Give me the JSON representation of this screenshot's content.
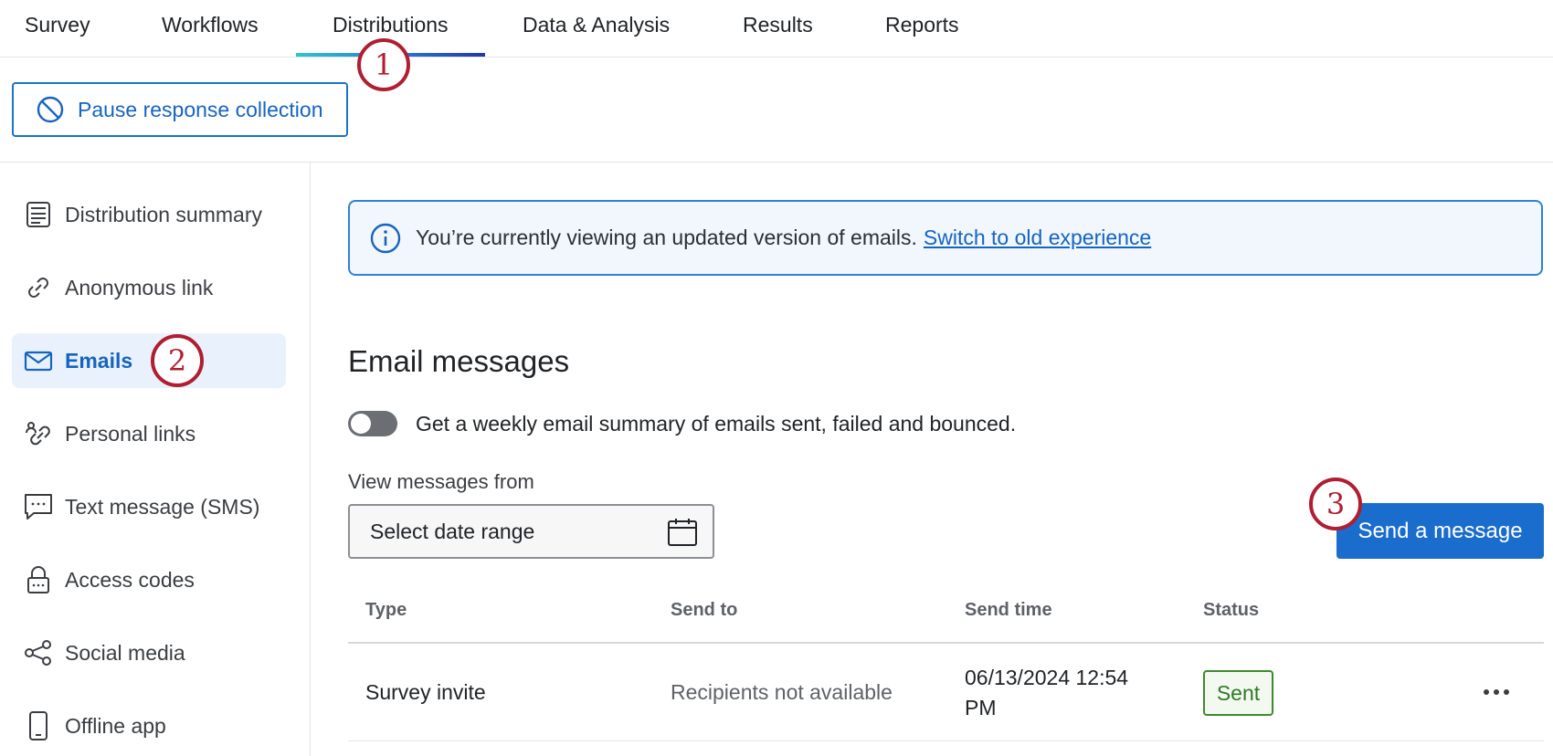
{
  "nav": {
    "tabs": [
      {
        "label": "Survey"
      },
      {
        "label": "Workflows"
      },
      {
        "label": "Distributions"
      },
      {
        "label": "Data & Analysis"
      },
      {
        "label": "Results"
      },
      {
        "label": "Reports"
      }
    ],
    "active_tab": "Distributions"
  },
  "pause_button": {
    "label": "Pause response collection",
    "icon": "block-icon"
  },
  "sidebar": {
    "items": [
      {
        "label": "Distribution summary",
        "icon": "summary-icon"
      },
      {
        "label": "Anonymous link",
        "icon": "link-icon"
      },
      {
        "label": "Emails",
        "icon": "mail-icon"
      },
      {
        "label": "Personal links",
        "icon": "personal-link-icon"
      },
      {
        "label": "Text message (SMS)",
        "icon": "sms-icon"
      },
      {
        "label": "Access codes",
        "icon": "lock-icon"
      },
      {
        "label": "Social media",
        "icon": "share-icon"
      },
      {
        "label": "Offline app",
        "icon": "phone-icon"
      }
    ],
    "active_item": "Emails"
  },
  "callouts": [
    "1",
    "2",
    "3"
  ],
  "banner": {
    "text": "You’re currently viewing an updated version of emails.",
    "link": "Switch to old experience"
  },
  "section": {
    "title": "Email messages",
    "toggle_label": "Get a weekly email summary of emails sent, failed and bounced.",
    "toggle_on": false,
    "date_label": "View messages from",
    "date_placeholder": "Select date range",
    "send_button": "Send a message"
  },
  "table": {
    "columns": [
      "Type",
      "Send to",
      "Send time",
      "Status"
    ],
    "rows": [
      {
        "type": "Survey invite",
        "send_to": "Recipients not available",
        "send_time_line1": "06/13/2024 12:54",
        "send_time_line2": "PM",
        "status": "Sent"
      }
    ]
  },
  "colors": {
    "accent": "#1a6dcc",
    "callout": "#b01e30",
    "status_sent": "#2f7a22"
  }
}
